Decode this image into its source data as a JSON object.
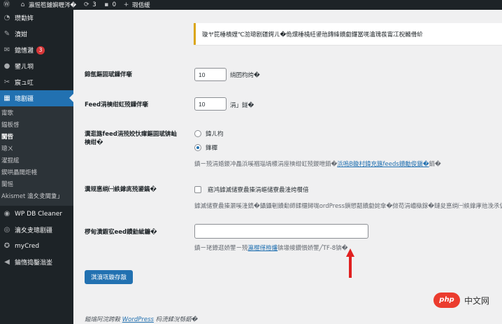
{
  "adminbar": {
    "site_title": "瀛愮笣鐪嬩嚦涔�",
    "updates_count": "3",
    "comments_count": "0",
    "new_label": "瑕佸缓"
  },
  "sidebar": {
    "items": [
      {
        "label": "瓒勫姩",
        "icon": "dashboard-icon"
      },
      {
        "label": "濆姏",
        "icon": "pin-icon"
      },
      {
        "label": "鎴愭灉",
        "icon": "comments-icon",
        "badge": "3"
      },
      {
        "label": "鐢ㄦ埛",
        "icon": "users-icon"
      },
      {
        "label": "宸ュ叿",
        "icon": "tools-icon"
      },
      {
        "label": "璁剧疆",
        "icon": "settings-icon",
        "current": true
      }
    ],
    "submenu": [
      "甯歌",
      "鎾板啓",
      "闃呰",
      "璁ㄨ",
      "濯掍綋",
      "鍥哄畾閾炬帴",
      "闅愮"
    ],
    "submenu_current_index": 2,
    "submenu_wrap": "Akismet 瀹夊叏閫夐」",
    "bottom_items": [
      {
        "label": "WP DB Cleaner",
        "icon": "database-icon"
      },
      {
        "label": "瀹夊叏璁剧疆",
        "icon": "shield-icon"
      },
      {
        "label": "myCred",
        "icon": "star-icon"
      },
      {
        "label": "鏀惰捣鑿滃崟",
        "icon": "collapse-icon"
      }
    ]
  },
  "notice": {
    "text": "璇ヤ笓棰樻娌℃湁璁剧疆鍔ㄦ�佹爣棰橈紝鍙兘鏄綘鐨勮鑼冨唴瀹瑰彂甯冮棿鏅傦紒"
  },
  "settings": {
    "posts_per_page": {
      "label": "鍗氬鏂囩珷鏁伴噺",
      "value": "10",
      "suffix": "绡囨枃绔�"
    },
    "feed_items": {
      "label": "Feed涓樉绀虹殑鏁伴噺",
      "value": "10",
      "suffix": "涓」鐩�"
    },
    "feed_content": {
      "label": "瀵逛簬feed涓殑姣忕瘒鏂囩珷锛屾樉绀�",
      "options": [
        "鍏ㄦ枃",
        "鎽樿"
      ],
      "selected_index": 1,
      "desc_prefix": "鎮ㄧ殑涓婚鍐冲畾浜嗘祻瑙堝櫒涓庢樉绀虹殑鍐呭銆�",
      "desc_link": "浜嗚В鏇村鍏充簬feeds鐨勪俊鎭�",
      "desc_suffix": "銆�"
    },
    "search_visibility": {
      "label": "瀵规悳绱㈠紩鎿庣殑鍙鎬�",
      "checkbox_label": "寤鸿鎼滅储寮曟搸涓嶇储寮曟湰绔欑偣",
      "desc": "鎼滅储寮曟搸灏嗘湰鐫�鑷鑷剦鐨勫師鍒欏鐞哤ordPress鎻愬嚭鐨勮姹傘�傚苟涓嶆槸鎵�鏈夋悳绱㈠紩鎿庨兘浼氶伒瀹堣繖绫昏姹�"
    },
    "feed_encoding": {
      "label": "椤甸潰鍜宖eed鐨勭紪鐮�",
      "value": "",
      "desc_prefix": "鎮ㄧ珯鐐逛娇鐢ㄧ殑",
      "desc_link": "瀛楃缂栫爜",
      "desc_suffix": "锛堟帹鑽愪娇鐢╱TF-8锛�"
    }
  },
  "save_button_label": "淇濆瓨鏇存敼",
  "footer": {
    "prefix": "鎰熻阿浣跨敤",
    "link": "WordPress",
    "suffix": "杩涜鍒涗綔銆�"
  },
  "watermark": {
    "logo": "php",
    "text": "中文网"
  },
  "colors": {
    "accent": "#2271b1",
    "sidebar_bg": "#1d2327",
    "notice_border": "#dba617",
    "badge": "#d63638",
    "arrow": "#e02020"
  }
}
